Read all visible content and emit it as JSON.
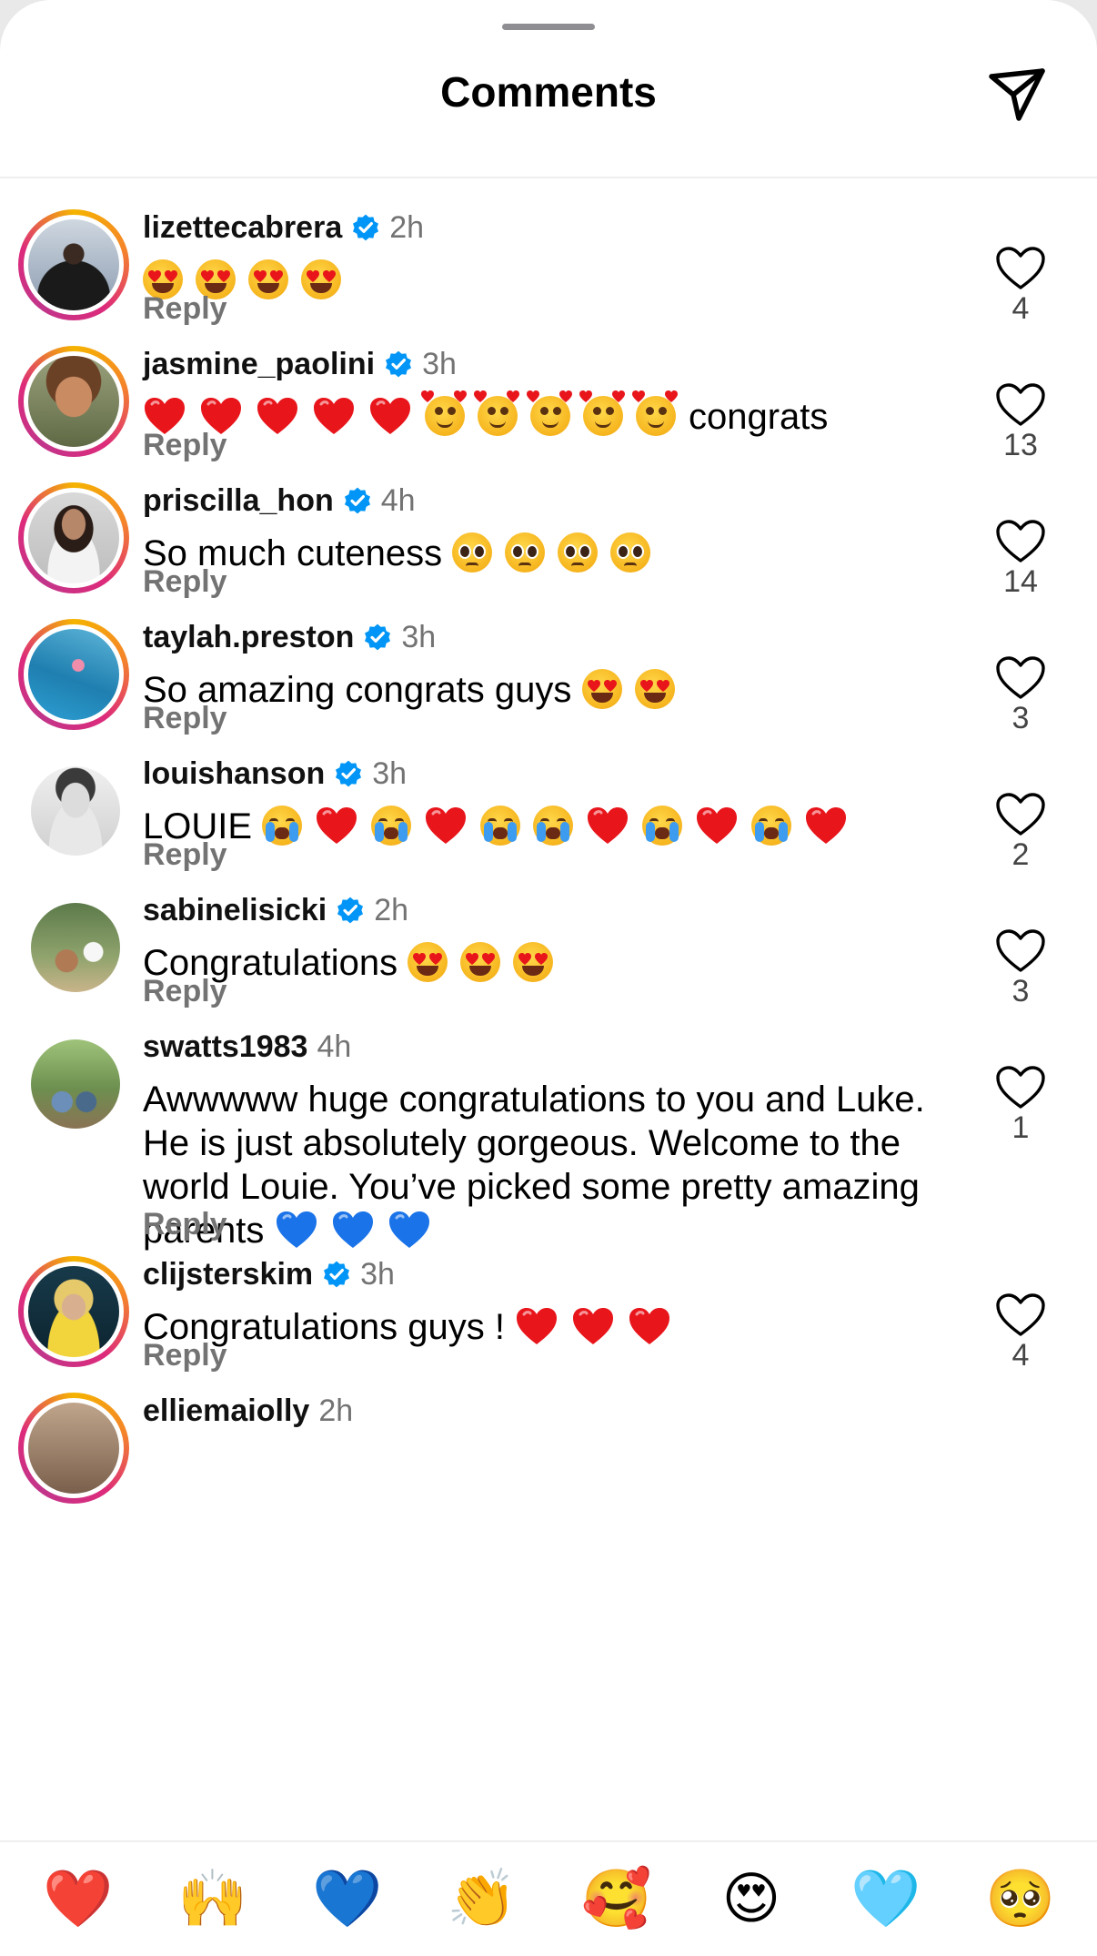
{
  "header": {
    "title": "Comments"
  },
  "comments": [
    {
      "username": "lizettecabrera",
      "verified": true,
      "time": "2h",
      "text": "",
      "emojis": [
        "heart-eyes",
        "heart-eyes",
        "heart-eyes",
        "heart-eyes"
      ],
      "reply": "Reply",
      "likes": "4"
    },
    {
      "username": "jasmine_paolini",
      "verified": true,
      "time": "3h",
      "text": "congrats",
      "emojis": [
        "red-heart",
        "red-heart",
        "red-heart",
        "red-heart",
        "red-heart",
        "smiling-hearts",
        "smiling-hearts",
        "smiling-hearts",
        "smiling-hearts",
        "smiling-hearts"
      ],
      "reply": "Reply",
      "likes": "13"
    },
    {
      "username": "priscilla_hon",
      "verified": true,
      "time": "4h",
      "text": "So much cuteness",
      "emojis": [
        "pleading",
        "pleading",
        "pleading",
        "pleading"
      ],
      "reply": "Reply",
      "likes": "14"
    },
    {
      "username": "taylah.preston",
      "verified": true,
      "time": "3h",
      "text": "So amazing congrats guys",
      "emojis": [
        "heart-eyes",
        "heart-eyes"
      ],
      "reply": "Reply",
      "likes": "3"
    },
    {
      "username": "louishanson",
      "verified": true,
      "time": "3h",
      "text": "LOUIE",
      "emojis": [
        "crying",
        "red-heart",
        "crying",
        "red-heart",
        "crying",
        "crying",
        "red-heart",
        "crying",
        "red-heart",
        "crying",
        "red-heart"
      ],
      "reply": "Reply",
      "likes": "2"
    },
    {
      "username": "sabinelisicki",
      "verified": true,
      "time": "2h",
      "text": "Congratulations",
      "emojis": [
        "heart-eyes",
        "heart-eyes",
        "heart-eyes"
      ],
      "reply": "Reply",
      "likes": "3"
    },
    {
      "username": "swatts1983",
      "verified": false,
      "time": "4h",
      "text": "Awwwww huge congratulations to you and Luke. He is just absolutely gorgeous. Welcome to the world Louie. You’ve picked some pretty amazing parents",
      "emojis": [
        "blue-heart",
        "blue-heart",
        "blue-heart"
      ],
      "reply": "Reply",
      "likes": "1"
    },
    {
      "username": "clijsterskim",
      "verified": true,
      "time": "3h",
      "text": "Congratulations guys !",
      "emojis": [
        "red-heart",
        "red-heart",
        "red-heart"
      ],
      "reply": "Reply",
      "likes": "4"
    },
    {
      "username": "elliemaiolly",
      "verified": false,
      "time": "2h",
      "text": "",
      "emojis": [],
      "reply": "",
      "likes": ""
    }
  ],
  "quick_reactions": [
    {
      "icon": "red-heart-icon",
      "glyph": "❤️"
    },
    {
      "icon": "raising-hands-icon",
      "glyph": "🙌"
    },
    {
      "icon": "blue-heart-icon",
      "glyph": "💙"
    },
    {
      "icon": "clapping-hands-icon",
      "glyph": "👏"
    },
    {
      "icon": "smiling-face-with-hearts-icon",
      "glyph": "🥰"
    },
    {
      "icon": "heart-eyes-icon",
      "glyph": "😍"
    },
    {
      "icon": "light-blue-heart-icon",
      "glyph": "🩵"
    },
    {
      "icon": "pleading-face-icon",
      "glyph": "🥺"
    }
  ],
  "colors": {
    "verified": "#0095f6",
    "secondary_text": "#737373",
    "heart_red": "#e8151b",
    "heart_blue": "#1a73e8"
  }
}
